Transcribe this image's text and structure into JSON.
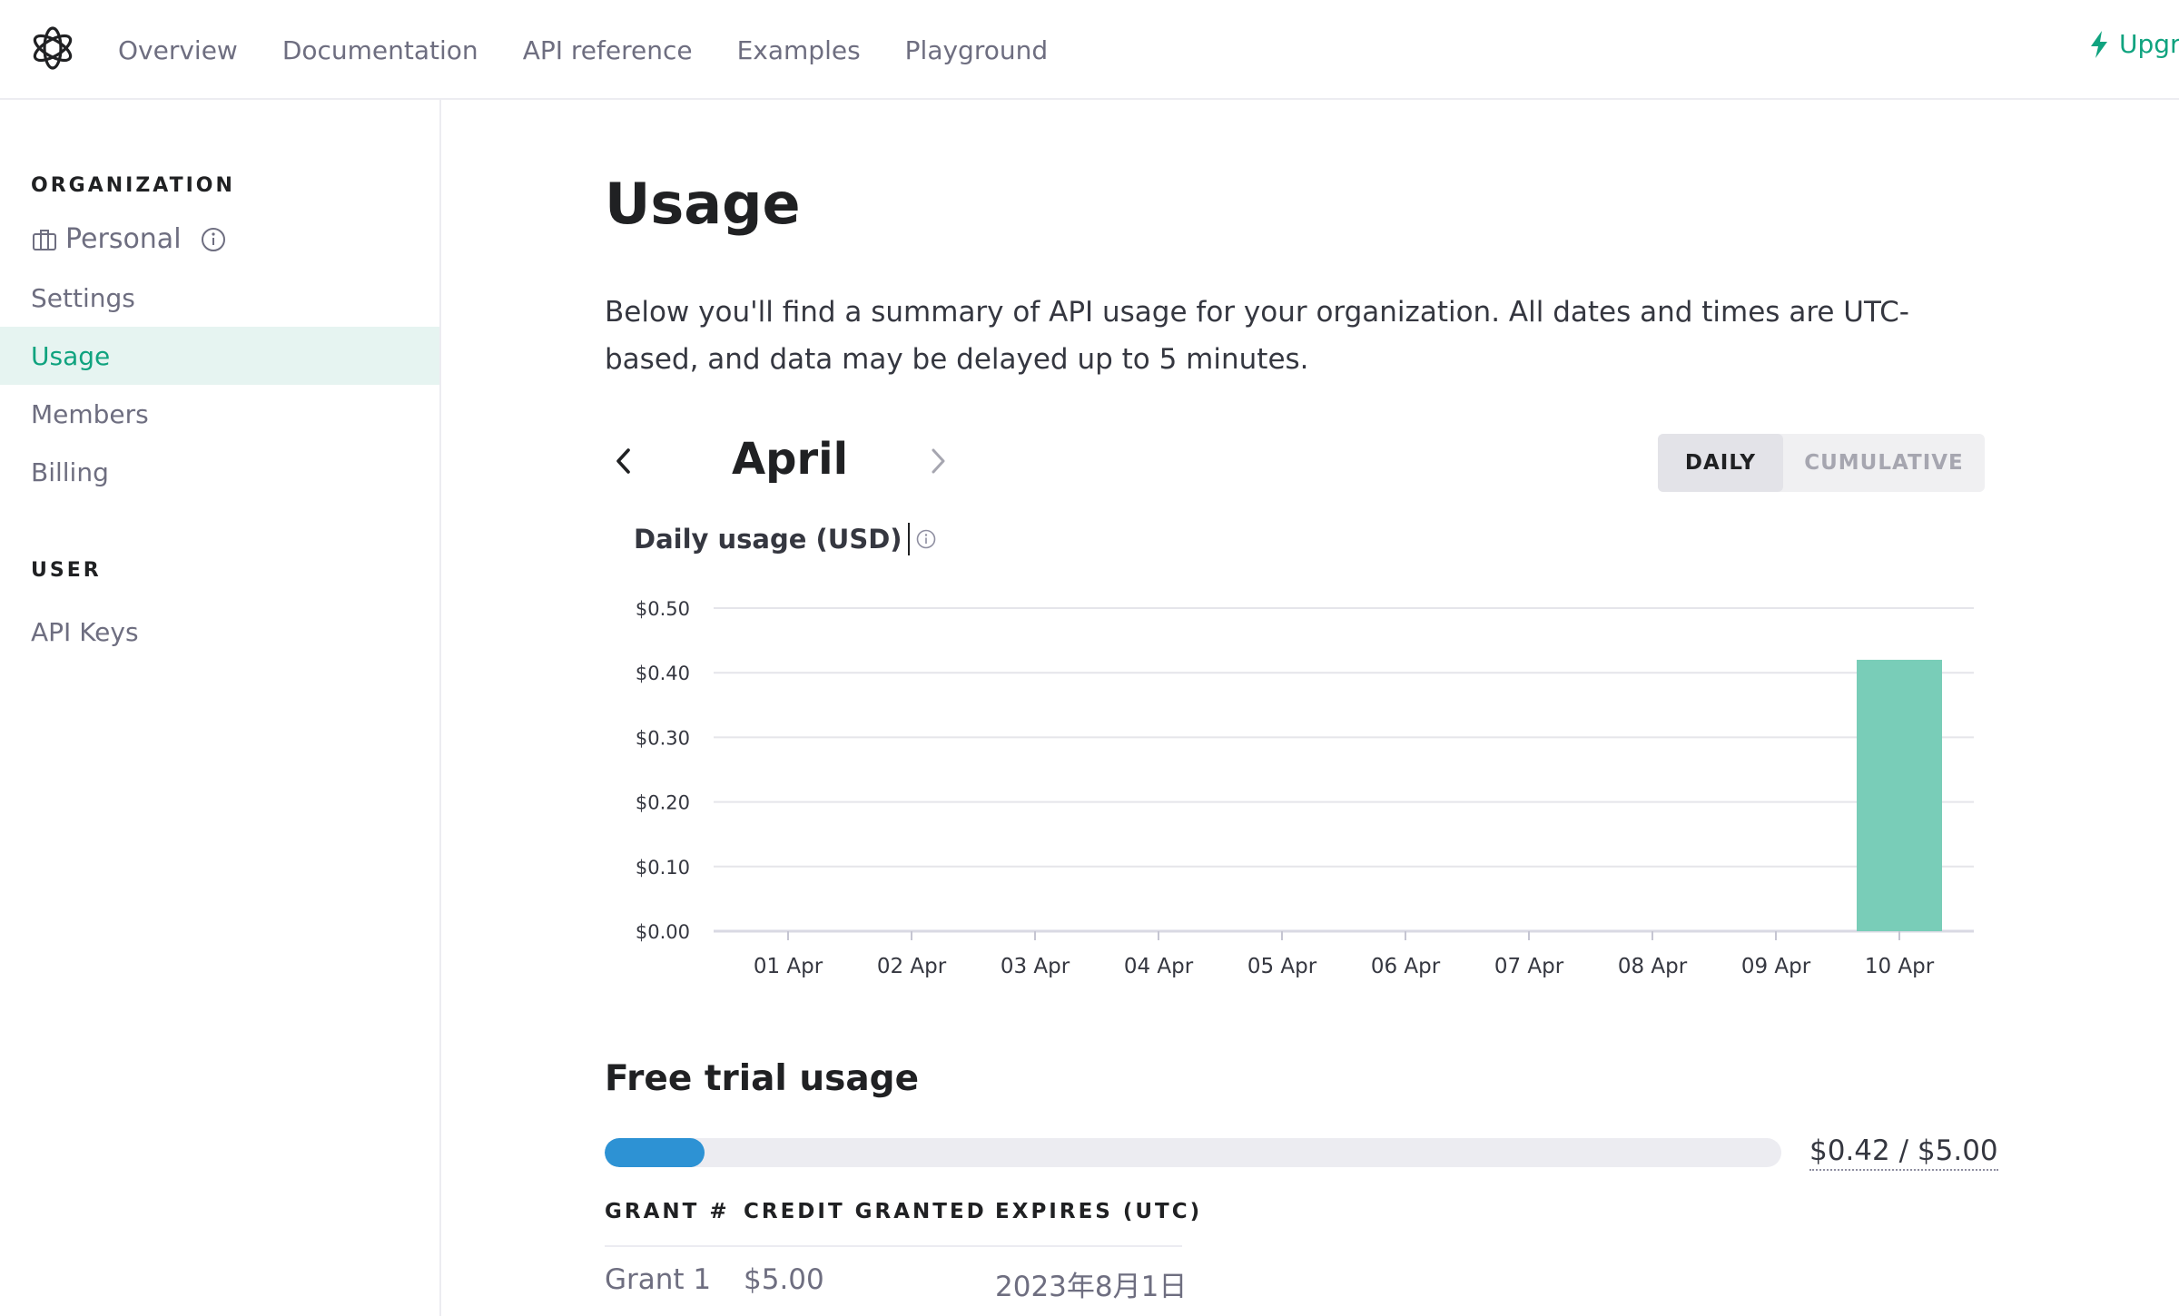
{
  "nav": {
    "links": [
      "Overview",
      "Documentation",
      "API reference",
      "Examples",
      "Playground"
    ],
    "upgrade_label": "Upgra",
    "accent": "#10a37f"
  },
  "sidebar": {
    "organization_heading": "ORGANIZATION",
    "org_name": "Personal",
    "items": [
      "Settings",
      "Usage",
      "Members",
      "Billing"
    ],
    "active_item": "Usage",
    "user_heading": "USER",
    "user_items": [
      "API Keys"
    ]
  },
  "main": {
    "title": "Usage",
    "intro": "Below you'll find a summary of API usage for your organization. All dates and times are UTC-based, and data may be delayed up to 5 minutes.",
    "month": "April",
    "toggle": {
      "daily": "DAILY",
      "cumulative": "CUMULATIVE",
      "selected": "DAILY"
    },
    "chart_title": "Daily usage (USD)"
  },
  "chart_data": {
    "type": "bar",
    "title": "Daily usage (USD)",
    "categories": [
      "01 Apr",
      "02 Apr",
      "03 Apr",
      "04 Apr",
      "05 Apr",
      "06 Apr",
      "07 Apr",
      "08 Apr",
      "09 Apr",
      "10 Apr"
    ],
    "values": [
      0,
      0,
      0,
      0,
      0,
      0,
      0,
      0,
      0,
      0.42
    ],
    "ylim": [
      0,
      0.5
    ],
    "yticks": [
      0,
      0.1,
      0.2,
      0.3,
      0.4,
      0.5
    ],
    "ytick_labels": [
      "$0.00",
      "$0.10",
      "$0.20",
      "$0.30",
      "$0.40",
      "$0.50"
    ],
    "grid": true,
    "bar_color": "#79cdb8"
  },
  "free_trial": {
    "title": "Free trial usage",
    "used": 0.42,
    "total": 5.0,
    "amount_label": "$0.42 / $5.00",
    "bar_color": "#2d92d4",
    "table": {
      "headers": [
        "GRANT #",
        "CREDIT GRANTED",
        "EXPIRES (UTC)"
      ],
      "rows": [
        [
          "Grant 1",
          "$5.00",
          "2023年8月1日"
        ]
      ]
    }
  }
}
